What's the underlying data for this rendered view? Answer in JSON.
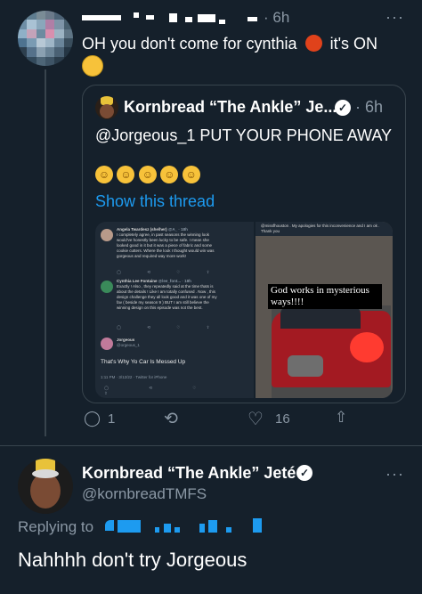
{
  "top_tweet": {
    "time": "· 6h",
    "text_line1": "OH you don't come for cynthia",
    "text_line1_suffix": "it's ON",
    "more_label": "···"
  },
  "quoted_tweet": {
    "author_name": "Kornbread “The Ankle” Je...",
    "time": "· 6h",
    "text": "@Jorgeous_1 PUT YOUR PHONE AWAY",
    "show_thread": "Show this thread",
    "emoji_count": 5
  },
  "left_image": {
    "tweet1_name": "Angela Twardesz (she/her)",
    "tweet1_meta": "@A_ · 18h",
    "tweet1_text": "I completely agree, in past seasons the winning look would've honestly been lucky to be safe. I mean she looked good in it but it was a piece of fabric and some cookie cutters. Where the look I thought would win was gorgeous and required way more work!",
    "tweet2_name": "Cynthia Lee Fontaine",
    "tweet2_meta": "@lee_font... · 18h",
    "tweet2_text": "Exactly ! Also , they repeatedly said at the time thats is about the details ! Like I am totally confused . Now , this design challenge they all look good and it was one of my fav ( beside my season 9 ) BUT I am still believe the winning design on this episode was not the best.",
    "tweet3_name": "Jorgeous",
    "tweet3_handle": "@orgeous_1",
    "tweet3_text": "That's Why Yo Car Is Messed Up",
    "tweet3_meta": "1:11 PM · 3/12/22 · Twitter for iPhone"
  },
  "right_image": {
    "top_text": "@missfhouston . My apologies for this inconvenience and I am ok . Thank you",
    "caption": "God works in mysterious ways!!!!"
  },
  "actions": {
    "reply_count": "1",
    "retweet_count": "",
    "like_count": "16"
  },
  "reply_tweet": {
    "author_name": "Kornbread “The Ankle” Jeté",
    "handle": "@kornbreadTMFS",
    "replying_to": "Replying to",
    "text": "Nahhhh don't try Jorgeous",
    "more_label": "···"
  },
  "colors": {
    "background": "#15202b",
    "accent": "#1d9bf0",
    "muted": "#8b98a5",
    "border": "#38444d"
  }
}
